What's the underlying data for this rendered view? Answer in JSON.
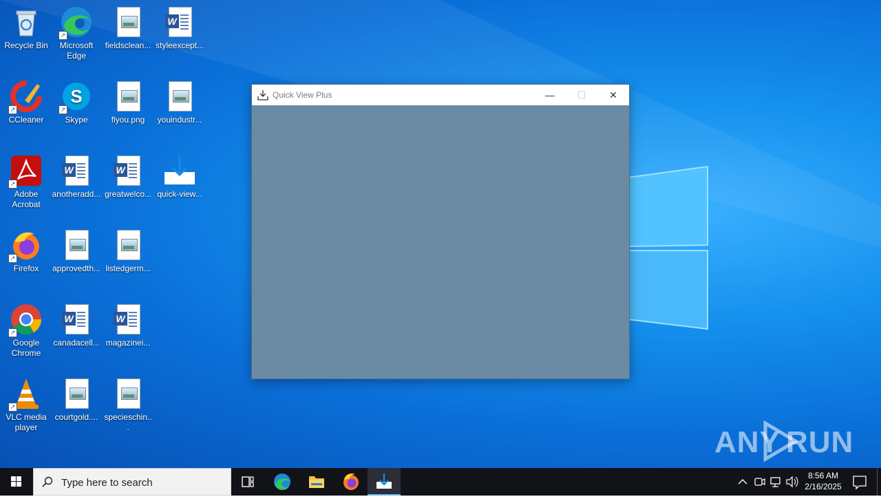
{
  "desktop": {
    "icons": [
      {
        "label": "Recycle Bin"
      },
      {
        "label": "Microsoft Edge"
      },
      {
        "label": "fieldsclean..."
      },
      {
        "label": "styleexcept..."
      },
      {
        "label": "CCleaner"
      },
      {
        "label": "Skype"
      },
      {
        "label": "flyou.png"
      },
      {
        "label": "youindustr..."
      },
      {
        "label": "Adobe Acrobat"
      },
      {
        "label": "anotheradd..."
      },
      {
        "label": "greatwelco..."
      },
      {
        "label": "quick-view..."
      },
      {
        "label": "Firefox"
      },
      {
        "label": "approvedth..."
      },
      {
        "label": "listedgerm..."
      },
      {
        "label": "Google Chrome"
      },
      {
        "label": "canadacell..."
      },
      {
        "label": "magazinei..."
      },
      {
        "label": "VLC media player"
      },
      {
        "label": "courtgold...."
      },
      {
        "label": "specieschin..."
      }
    ],
    "watermark": "ANY RUN"
  },
  "window": {
    "title": "Quick View Plus",
    "minimize": "—",
    "maximize": "☐",
    "close": "✕"
  },
  "taskbar": {
    "search_placeholder": "Type here to search",
    "time": "8:56 AM",
    "date": "2/16/2025"
  },
  "colors": {
    "window_content": "#6b8ba4",
    "taskbar": "#111318",
    "desktop_accent": "#1591ee"
  }
}
